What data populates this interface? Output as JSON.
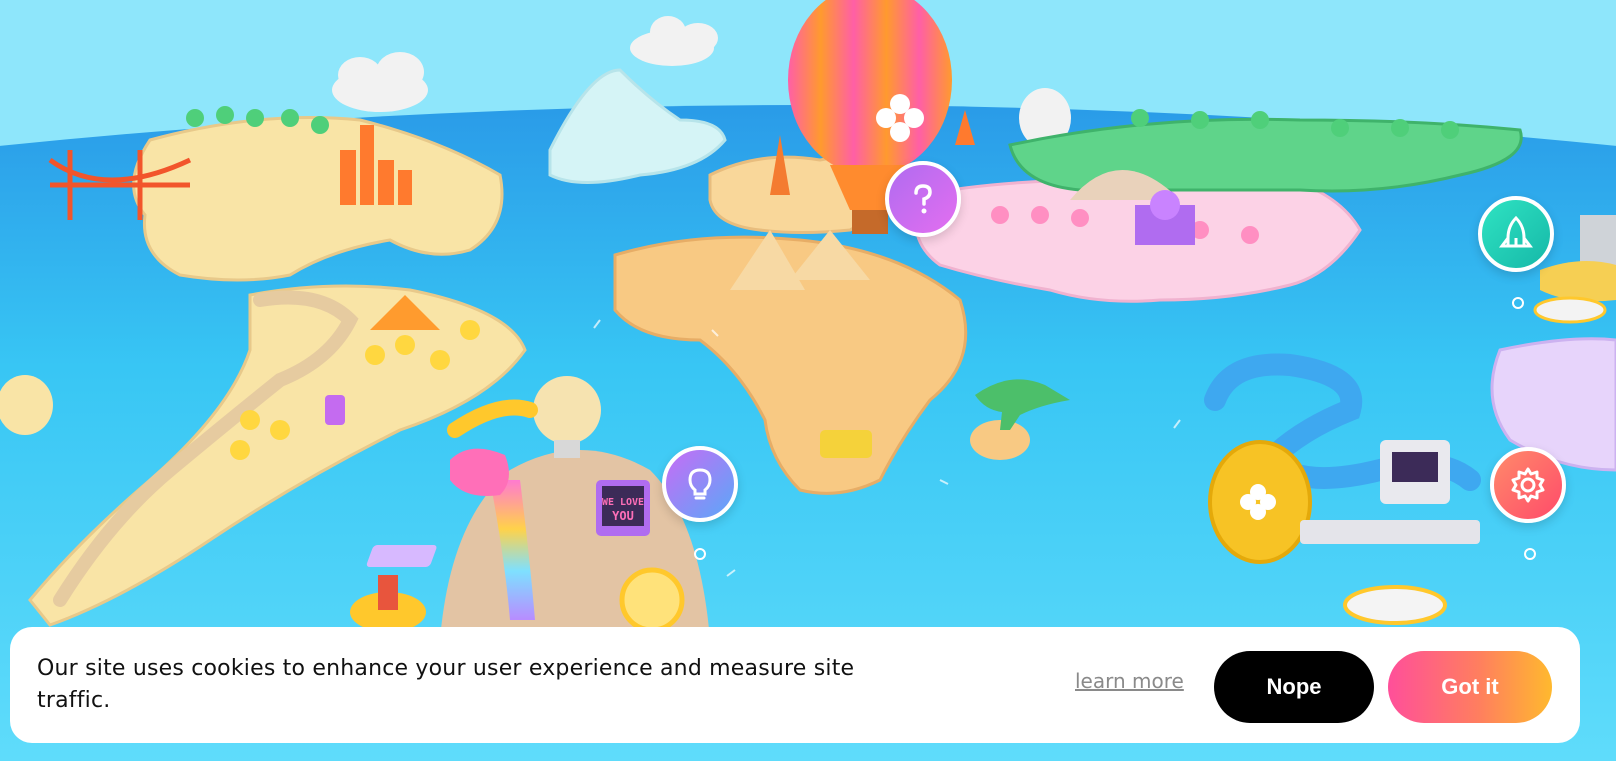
{
  "hotspots": [
    {
      "name": "help-hotspot",
      "icon": "question-icon"
    },
    {
      "name": "idea-hotspot",
      "icon": "lightbulb-icon"
    },
    {
      "name": "launch-hotspot",
      "icon": "rocket-icon"
    },
    {
      "name": "settings-hotspot",
      "icon": "gear-icon"
    }
  ],
  "scene": {
    "monitor_text_line1": "WE LOVE",
    "monitor_text_line2": "YOU"
  },
  "cookie_banner": {
    "message": "Our site uses cookies to enhance your user experience and measure site traffic.",
    "learn_more_label": "learn more",
    "decline_label": "Nope",
    "accept_label": "Got it"
  },
  "colors": {
    "sky": "#8ee6fb",
    "ocean": "#37c8f4",
    "accept_gradient_start": "#ff4f9a",
    "accept_gradient_end": "#ffb92e",
    "decline_bg": "#000000"
  }
}
